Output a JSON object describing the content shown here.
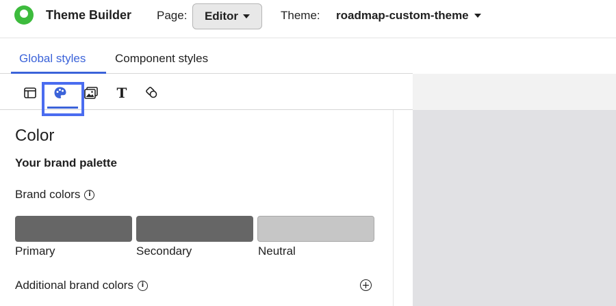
{
  "header": {
    "app_title": "Theme Builder",
    "page_label": "Page:",
    "page_value": "Editor",
    "theme_label": "Theme:",
    "theme_value": "roadmap-custom-theme"
  },
  "tabs": [
    {
      "label": "Global styles",
      "active": true
    },
    {
      "label": "Component styles",
      "active": false
    }
  ],
  "icon_bar": [
    {
      "icon": "layout-icon"
    },
    {
      "icon": "palette-icon",
      "active": true
    },
    {
      "icon": "image-icon"
    },
    {
      "icon": "typography-icon",
      "glyph": "T"
    },
    {
      "icon": "shapes-icon"
    }
  ],
  "panel": {
    "title": "Color",
    "subtitle": "Your brand palette",
    "brand_colors_label": "Brand colors",
    "swatches": [
      {
        "label": "Primary",
        "color": "#666666"
      },
      {
        "label": "Secondary",
        "color": "#666666"
      },
      {
        "label": "Neutral",
        "color": "#c6c6c6"
      }
    ],
    "additional_label": "Additional brand colors"
  },
  "colors": {
    "accent": "#3b63d9",
    "highlight": "#4a6cf0",
    "logo": "#3dbb3d",
    "canvas": "#e1e1e4"
  }
}
